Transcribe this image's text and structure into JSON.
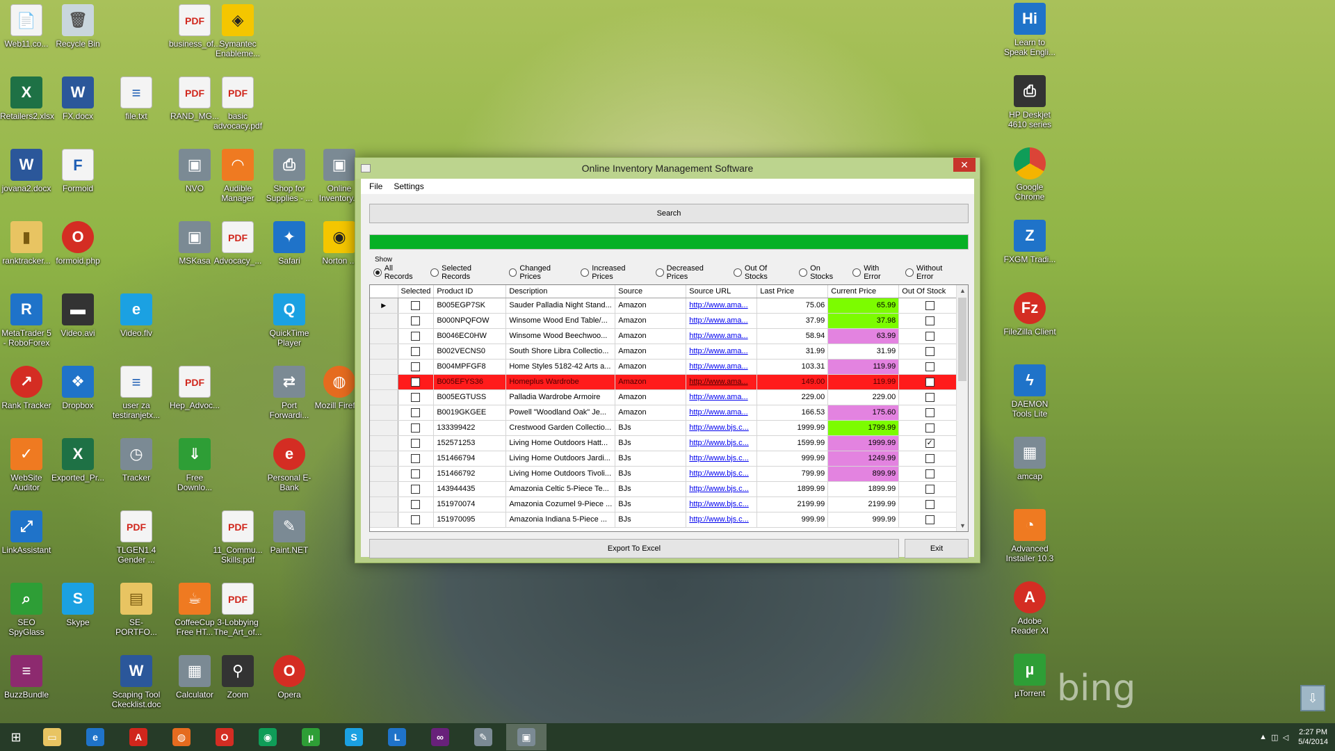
{
  "desktop_icons_left": [
    {
      "label": "Web11.co...",
      "icon": "document-icon",
      "glyph": "📄"
    },
    {
      "label": "Recycle Bin",
      "icon": "recycle-bin-icon",
      "glyph": "🗑"
    },
    {
      "label": "business_of...",
      "icon": "pdf-icon",
      "glyph": "PDF"
    },
    {
      "label": "Symantec Enableme...",
      "icon": "symantec-icon",
      "glyph": "◈"
    },
    {
      "label": "Retailers2.xlsx",
      "icon": "excel-icon",
      "glyph": "X"
    },
    {
      "label": "FX.docx",
      "icon": "word-icon",
      "glyph": "W"
    },
    {
      "label": "file.txt",
      "icon": "text-file-icon",
      "glyph": "≡"
    },
    {
      "label": "RAND_MG...",
      "icon": "pdf-icon",
      "glyph": "PDF"
    },
    {
      "label": "basic advocacy.pdf",
      "icon": "pdf-icon",
      "glyph": "PDF"
    },
    {
      "label": "jovana2.docx",
      "icon": "word-icon",
      "glyph": "W"
    },
    {
      "label": "Formoid",
      "icon": "formoid-icon",
      "glyph": "F"
    },
    {
      "label": "NVO",
      "icon": "shortcut-icon",
      "glyph": "▣"
    },
    {
      "label": "Audible Manager",
      "icon": "audible-icon",
      "glyph": "◠"
    },
    {
      "label": "Shop for Supplies - ...",
      "icon": "printer-shop-icon",
      "glyph": "⎙"
    },
    {
      "label": "Online Inventory...",
      "icon": "app-shortcut-icon",
      "glyph": "▣"
    },
    {
      "label": "ranktracker...",
      "icon": "rank-folder-icon",
      "glyph": "▮"
    },
    {
      "label": "formoid.php",
      "icon": "opera-icon",
      "glyph": "O"
    },
    {
      "label": "MSKasa",
      "icon": "shortcut-icon",
      "glyph": "▣"
    },
    {
      "label": "Advocacy_...",
      "icon": "pdf-icon",
      "glyph": "PDF"
    },
    {
      "label": "Safari",
      "icon": "safari-icon",
      "glyph": "✦"
    },
    {
      "label": "Norton ...",
      "icon": "norton-icon",
      "glyph": "◉"
    },
    {
      "label": "MetaTrader 5 - RoboForex",
      "icon": "metatrader-icon",
      "glyph": "R"
    },
    {
      "label": "Video.avi",
      "icon": "video-icon",
      "glyph": "▬"
    },
    {
      "label": "Video.flv",
      "icon": "ie-icon",
      "glyph": "e"
    },
    {
      "label": "QuickTime Player",
      "icon": "quicktime-icon",
      "glyph": "Q"
    },
    {
      "label": "Rank Tracker",
      "icon": "rank-tracker-icon",
      "glyph": "↗"
    },
    {
      "label": "Dropbox",
      "icon": "dropbox-icon",
      "glyph": "❖"
    },
    {
      "label": "user za testiranjetx...",
      "icon": "text-file-icon",
      "glyph": "≡"
    },
    {
      "label": "Hep_Advoc...",
      "icon": "pdf-icon",
      "glyph": "PDF"
    },
    {
      "label": "Port Forwardi...",
      "icon": "network-icon",
      "glyph": "⇄"
    },
    {
      "label": "Mozill Firefox",
      "icon": "firefox-icon",
      "glyph": "◍"
    },
    {
      "label": "WebSite Auditor",
      "icon": "website-auditor-icon",
      "glyph": "✓"
    },
    {
      "label": "Exported_Pr...",
      "icon": "excel-icon",
      "glyph": "X"
    },
    {
      "label": "Tracker",
      "icon": "clock-icon",
      "glyph": "◷"
    },
    {
      "label": "Free Downlo...",
      "icon": "download-icon",
      "glyph": "⇓"
    },
    {
      "label": "Personal E-Bank",
      "icon": "ebank-icon",
      "glyph": "e"
    },
    {
      "label": "LinkAssistant",
      "icon": "link-assistant-icon",
      "glyph": "⤢"
    },
    {
      "label": "TLGEN1.4 Gender ...",
      "icon": "pdf-icon",
      "glyph": "PDF"
    },
    {
      "label": "11_Commu... Skills.pdf",
      "icon": "pdf-icon",
      "glyph": "PDF"
    },
    {
      "label": "Paint.NET",
      "icon": "paint-icon",
      "glyph": "✎"
    },
    {
      "label": "SEO SpyGlass",
      "icon": "spyglass-icon",
      "glyph": "⌕"
    },
    {
      "label": "Skype",
      "icon": "skype-icon",
      "glyph": "S"
    },
    {
      "label": "SE-PORTFO...",
      "icon": "zip-folder-icon",
      "glyph": "▤"
    },
    {
      "label": "CoffeeCup Free HT...",
      "icon": "coffeecup-icon",
      "glyph": "☕"
    },
    {
      "label": "3-Lobbying The_Art_of...",
      "icon": "pdf-icon",
      "glyph": "PDF"
    },
    {
      "label": "BuzzBundle",
      "icon": "buzzbundle-icon",
      "glyph": "≡"
    },
    {
      "label": "Scaping Tool Ckecklist.doc",
      "icon": "word-icon",
      "glyph": "W"
    },
    {
      "label": "Calculator",
      "icon": "calculator-icon",
      "glyph": "▦"
    },
    {
      "label": "Zoom",
      "icon": "binoculars-icon",
      "glyph": "⚲"
    },
    {
      "label": "Opera",
      "icon": "opera-icon",
      "glyph": "O"
    }
  ],
  "desktop_icons_right": [
    {
      "label": "Learn to Speak Engli...",
      "icon": "hello-icon",
      "glyph": "Hi"
    },
    {
      "label": "HP Deskjet 4610 series",
      "icon": "printer-icon",
      "glyph": "⎙"
    },
    {
      "label": "Google Chrome",
      "icon": "chrome-icon",
      "glyph": ""
    },
    {
      "label": "FXGM Tradi...",
      "icon": "fxgm-icon",
      "glyph": "Z"
    },
    {
      "label": "FileZilla Client",
      "icon": "filezilla-icon",
      "glyph": "Fz"
    },
    {
      "label": "DAEMON Tools Lite",
      "icon": "daemon-tools-icon",
      "glyph": "ϟ"
    },
    {
      "label": "amcap",
      "icon": "amcap-icon",
      "glyph": "▦"
    },
    {
      "label": "Advanced Installer 10.3",
      "icon": "installer-icon",
      "glyph": "◔"
    },
    {
      "label": "Adobe Reader XI",
      "icon": "adobe-reader-icon",
      "glyph": "A"
    },
    {
      "label": "µTorrent",
      "icon": "utorrent-icon",
      "glyph": "µ"
    }
  ],
  "window": {
    "title": "Online Inventory Management Software",
    "close": "✕",
    "menu": [
      "File",
      "Settings"
    ],
    "search_label": "Search",
    "progress_percent": 100,
    "show_label": "Show",
    "radios": [
      {
        "label": "All Records",
        "checked": true
      },
      {
        "label": "Selected Records",
        "checked": false
      },
      {
        "label": "Changed Prices",
        "checked": false
      },
      {
        "label": "Increased Prices",
        "checked": false
      },
      {
        "label": "Decreased Prices",
        "checked": false
      },
      {
        "label": "Out Of Stocks",
        "checked": false
      },
      {
        "label": "On Stocks",
        "checked": false
      },
      {
        "label": "With Error",
        "checked": false
      },
      {
        "label": "Without Error",
        "checked": false
      }
    ],
    "columns": [
      "Selected",
      "Product ID",
      "Description",
      "Source",
      "Source URL",
      "Last Price",
      "Current Price",
      "Out Of Stock"
    ],
    "rows": [
      {
        "id": "B005EGP7SK",
        "desc": "Sauder Palladia Night Stand...",
        "source": "Amazon",
        "url": "http://www.ama...",
        "last": "75.06",
        "current": "65.99",
        "hl": "green",
        "oos": false,
        "err": false,
        "cur": true
      },
      {
        "id": "B000NPQFOW",
        "desc": "Winsome Wood End Table/...",
        "source": "Amazon",
        "url": "http://www.ama...",
        "last": "37.99",
        "current": "37.98",
        "hl": "green",
        "oos": false,
        "err": false
      },
      {
        "id": "B0046EC0HW",
        "desc": "Winsome Wood Beechwoo...",
        "source": "Amazon",
        "url": "http://www.ama...",
        "last": "58.94",
        "current": "63.99",
        "hl": "pink",
        "oos": false,
        "err": false
      },
      {
        "id": "B002VECNS0",
        "desc": "South Shore Libra Collectio...",
        "source": "Amazon",
        "url": "http://www.ama...",
        "last": "31.99",
        "current": "31.99",
        "hl": "",
        "oos": false,
        "err": false
      },
      {
        "id": "B004MPFGF8",
        "desc": "Home Styles 5182-42 Arts a...",
        "source": "Amazon",
        "url": "http://www.ama...",
        "last": "103.31",
        "current": "119.99",
        "hl": "pink",
        "oos": false,
        "err": false
      },
      {
        "id": "B005EFYS36",
        "desc": "Homeplus Wardrobe",
        "source": "Amazon",
        "url": "http://www.ama...",
        "last": "149.00",
        "current": "119.99",
        "hl": "green",
        "oos": false,
        "err": true
      },
      {
        "id": "B005EGTUSS",
        "desc": "Palladia Wardrobe Armoire",
        "source": "Amazon",
        "url": "http://www.ama...",
        "last": "229.00",
        "current": "229.00",
        "hl": "",
        "oos": false,
        "err": false
      },
      {
        "id": "B0019GKGEE",
        "desc": "Powell \"Woodland Oak\" Je...",
        "source": "Amazon",
        "url": "http://www.ama...",
        "last": "166.53",
        "current": "175.60",
        "hl": "pink",
        "oos": false,
        "err": false
      },
      {
        "id": "133399422",
        "desc": "Crestwood Garden Collectio...",
        "source": "BJs",
        "url": "http://www.bjs.c...",
        "last": "1999.99",
        "current": "1799.99",
        "hl": "green",
        "oos": false,
        "err": false
      },
      {
        "id": "152571253",
        "desc": "Living Home Outdoors Hatt...",
        "source": "BJs",
        "url": "http://www.bjs.c...",
        "last": "1599.99",
        "current": "1999.99",
        "hl": "pink",
        "oos": true,
        "err": false
      },
      {
        "id": "151466794",
        "desc": "Living Home Outdoors Jardi...",
        "source": "BJs",
        "url": "http://www.bjs.c...",
        "last": "999.99",
        "current": "1249.99",
        "hl": "pink",
        "oos": false,
        "err": false
      },
      {
        "id": "151466792",
        "desc": "Living Home Outdoors Tivoli...",
        "source": "BJs",
        "url": "http://www.bjs.c...",
        "last": "799.99",
        "current": "899.99",
        "hl": "pink",
        "oos": false,
        "err": false
      },
      {
        "id": "143944435",
        "desc": "Amazonia Celtic 5-Piece Te...",
        "source": "BJs",
        "url": "http://www.bjs.c...",
        "last": "1899.99",
        "current": "1899.99",
        "hl": "",
        "oos": false,
        "err": false
      },
      {
        "id": "151970074",
        "desc": "Amazonia Cozumel 9-Piece ...",
        "source": "BJs",
        "url": "http://www.bjs.c...",
        "last": "2199.99",
        "current": "2199.99",
        "hl": "",
        "oos": false,
        "err": false
      },
      {
        "id": "151970095",
        "desc": "Amazonia Indiana 5-Piece ...",
        "source": "BJs",
        "url": "http://www.bjs.c...",
        "last": "999.99",
        "current": "999.99",
        "hl": "",
        "oos": false,
        "err": false
      }
    ],
    "export_label": "Export To Excel",
    "exit_label": "Exit"
  },
  "taskbar": {
    "start": "⊞",
    "apps": [
      {
        "name": "file-explorer-icon",
        "glyph": "▭",
        "color": "#e8c462"
      },
      {
        "name": "internet-explorer-icon",
        "glyph": "e",
        "color": "#1f73c9"
      },
      {
        "name": "adobe-acrobat-icon",
        "glyph": "A",
        "color": "#d0261c"
      },
      {
        "name": "firefox-icon",
        "glyph": "◍",
        "color": "#e56b1f"
      },
      {
        "name": "opera-icon",
        "glyph": "O",
        "color": "#d42d23"
      },
      {
        "name": "chrome-icon",
        "glyph": "◉",
        "color": "#0f9d58"
      },
      {
        "name": "utorrent-icon",
        "glyph": "µ",
        "color": "#2e9e36"
      },
      {
        "name": "skype-icon",
        "glyph": "S",
        "color": "#1ba1e2"
      },
      {
        "name": "lync-icon",
        "glyph": "L",
        "color": "#1f73c9"
      },
      {
        "name": "visual-studio-icon",
        "glyph": "∞",
        "color": "#68217a"
      },
      {
        "name": "paint-icon",
        "glyph": "✎",
        "color": "#7b8a94"
      },
      {
        "name": "inventory-app-icon",
        "glyph": "▣",
        "color": "#7b8a94"
      }
    ],
    "time": "2:27 PM",
    "date": "5/4/2014"
  },
  "bing_text": "bing"
}
